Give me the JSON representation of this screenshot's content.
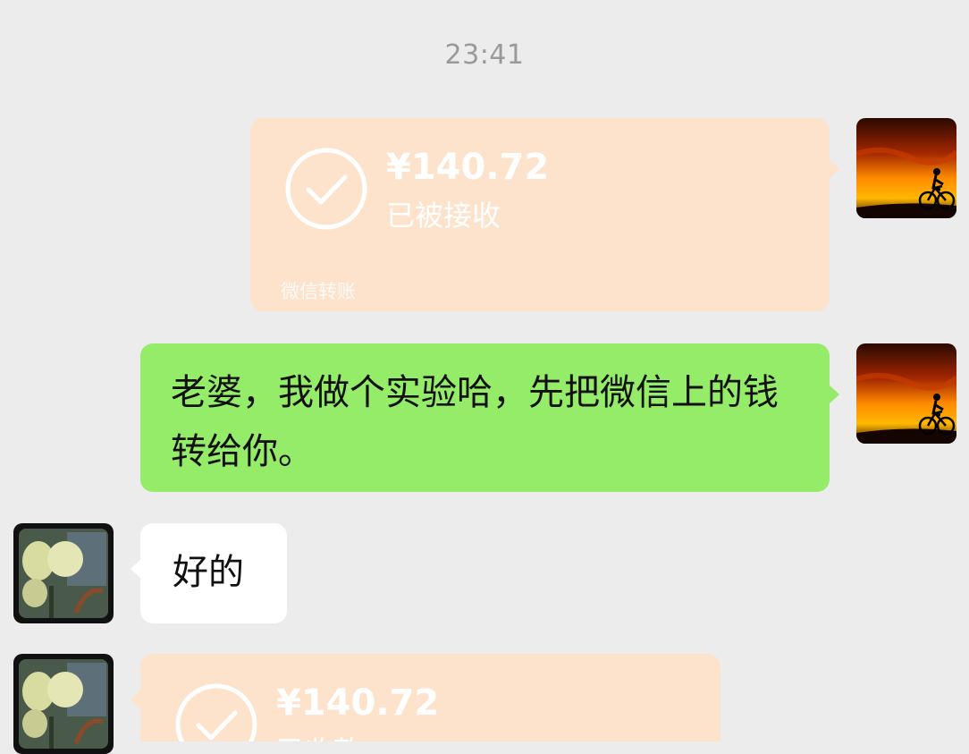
{
  "chat": {
    "timestamp": "23:41",
    "messages": [
      {
        "sender": "me",
        "type": "transfer",
        "amount": "¥140.72",
        "status": "已被接收",
        "footer": "微信转账"
      },
      {
        "sender": "me",
        "type": "text",
        "text": "老婆，我做个实验哈，先把微信上的钱转给你。"
      },
      {
        "sender": "other",
        "type": "text",
        "text": "好的"
      },
      {
        "sender": "other",
        "type": "transfer",
        "amount": "¥140.72",
        "status": "已收款"
      }
    ]
  },
  "colors": {
    "background": "#ececec",
    "transfer_bubble": "#fde3cb",
    "sent_bubble": "#95ec69",
    "received_bubble": "#ffffff"
  },
  "icons": {
    "my_avatar": "sunset-cyclist-avatar-image",
    "other_avatar": "flower-avatar-image",
    "transfer_check": "check-circle-icon"
  }
}
